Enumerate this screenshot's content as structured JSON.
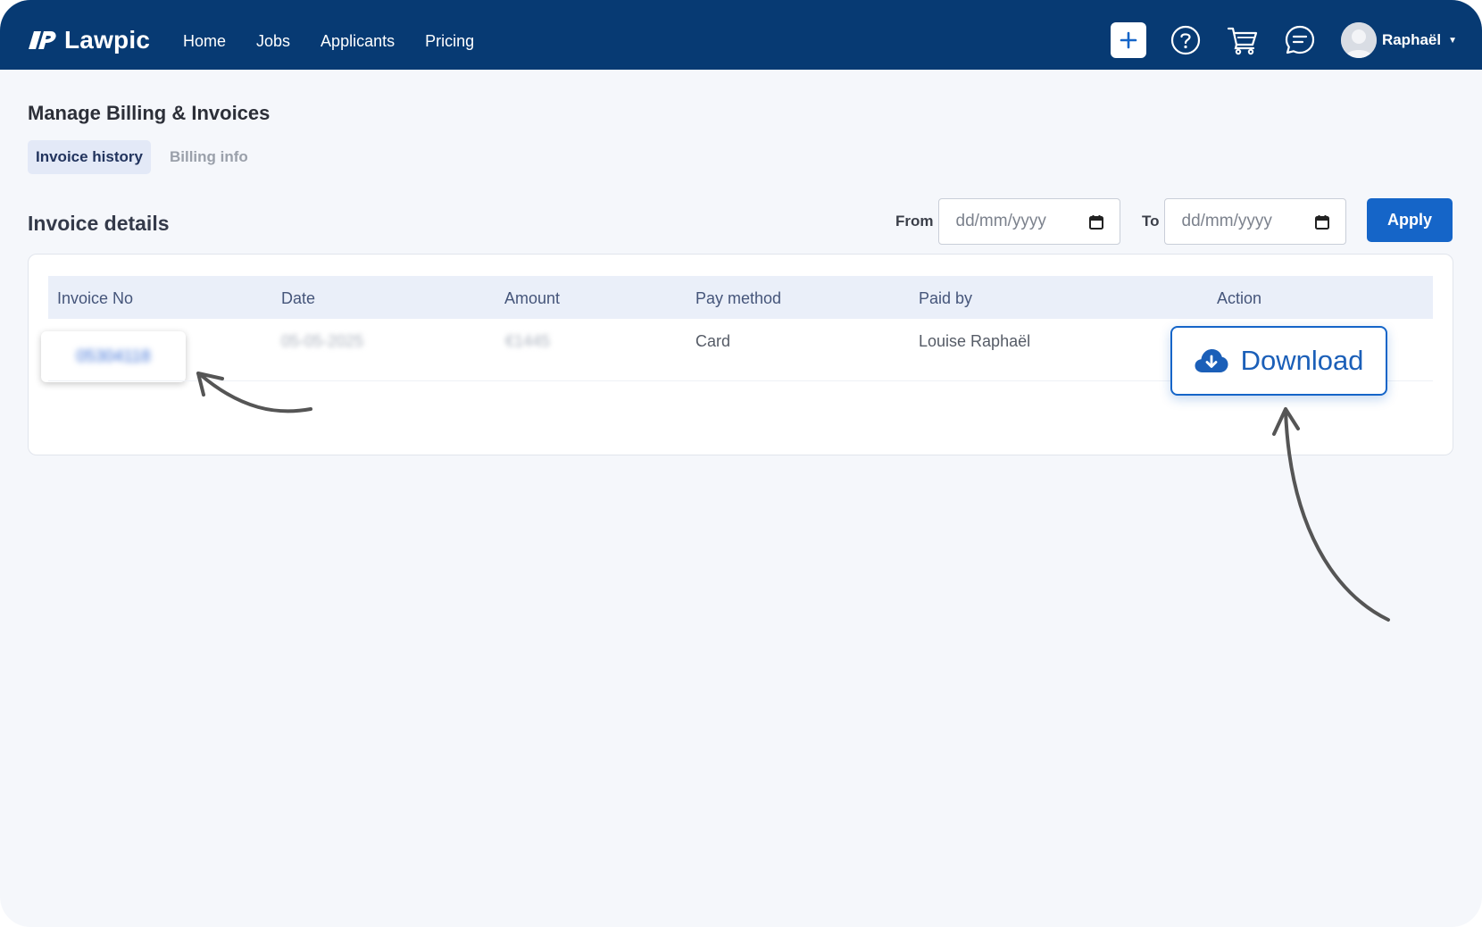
{
  "app": {
    "name": "Lawpic"
  },
  "nav": {
    "links": [
      "Home",
      "Jobs",
      "Applicants",
      "Pricing"
    ],
    "user_name": "Raphaël"
  },
  "page": {
    "title": "Manage Billing & Invoices",
    "tabs": [
      {
        "label": "Invoice history",
        "active": true
      },
      {
        "label": "Billing info",
        "active": false
      }
    ]
  },
  "invoice_section": {
    "title": "Invoice details",
    "from_label": "From",
    "to_label": "To",
    "from_placeholder": "dd/mm/yyyy",
    "to_placeholder": "dd/mm/yyyy",
    "apply_label": "Apply"
  },
  "table": {
    "columns": [
      "Invoice No",
      "Date",
      "Amount",
      "Pay method",
      "Paid by",
      "Action"
    ],
    "rows": [
      {
        "invoice_no": "05304118",
        "date": "05-05-2025",
        "amount": "€1445",
        "pay_method": "Card",
        "paid_by": "Louise Raphaël",
        "action_label": "Download"
      }
    ]
  },
  "colors": {
    "nav_bg": "#073a73",
    "primary": "#1565c8",
    "page_bg": "#f5f7fb",
    "table_header_bg": "#eaeff9"
  },
  "icons": [
    "logo-icon",
    "plus-icon",
    "help-icon",
    "cart-icon",
    "chat-icon",
    "avatar-icon",
    "calendar-icon",
    "cloud-download-icon",
    "arrow-annotation-icon"
  ]
}
